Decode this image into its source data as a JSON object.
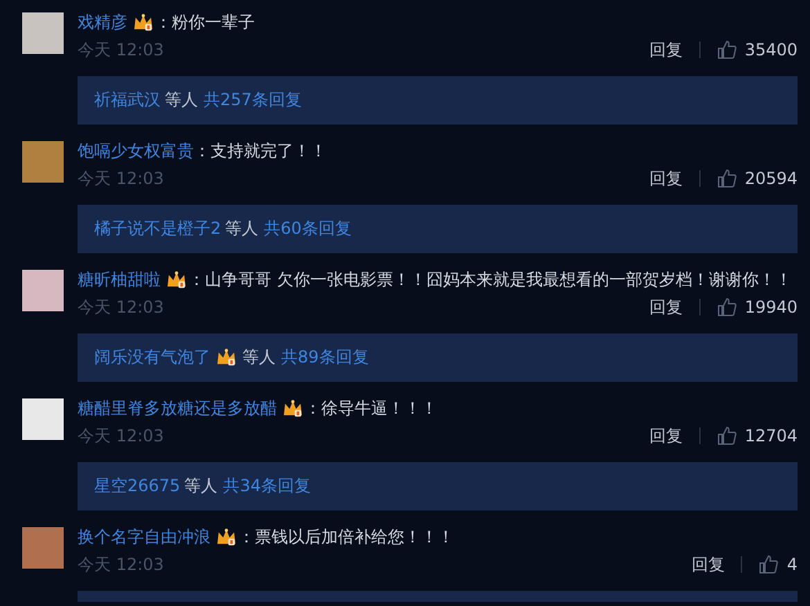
{
  "comments": [
    {
      "user": "戏精彦",
      "badge": true,
      "text": "：粉你一辈子",
      "time": "今天 12:03",
      "reply": "回复",
      "likes": "35400",
      "thread": {
        "user": "祈福武汉",
        "badge": false,
        "others": "等人",
        "total": "共257条回复"
      }
    },
    {
      "user": "饱嗝少女权富贵",
      "badge": false,
      "text": "：支持就完了！！",
      "time": "今天 12:03",
      "reply": "回复",
      "likes": "20594",
      "thread": {
        "user": "橘子说不是橙子2",
        "badge": false,
        "others": "等人",
        "total": "共60条回复"
      }
    },
    {
      "user": "糖昕柚甜啦",
      "badge": true,
      "text": "：山争哥哥 欠你一张电影票！！囧妈本来就是我最想看的一部贺岁档！谢谢你！！",
      "time": "今天 12:03",
      "reply": "回复",
      "likes": "19940",
      "thread": {
        "user": "阔乐没有气泡了",
        "badge": true,
        "others": "等人",
        "total": "共89条回复"
      }
    },
    {
      "user": "糖醋里脊多放糖还是多放醋",
      "badge": true,
      "text": "：徐导牛逼！！！",
      "time": "今天 12:03",
      "reply": "回复",
      "likes": "12704",
      "thread": {
        "user": "星空26675",
        "badge": false,
        "others": "等人",
        "total": "共34条回复"
      }
    },
    {
      "user": "换个名字自由冲浪",
      "badge": true,
      "text": "：票钱以后加倍补给您！！！",
      "time": "今天 12:03",
      "reply": "回复",
      "likes": "4"
    }
  ]
}
